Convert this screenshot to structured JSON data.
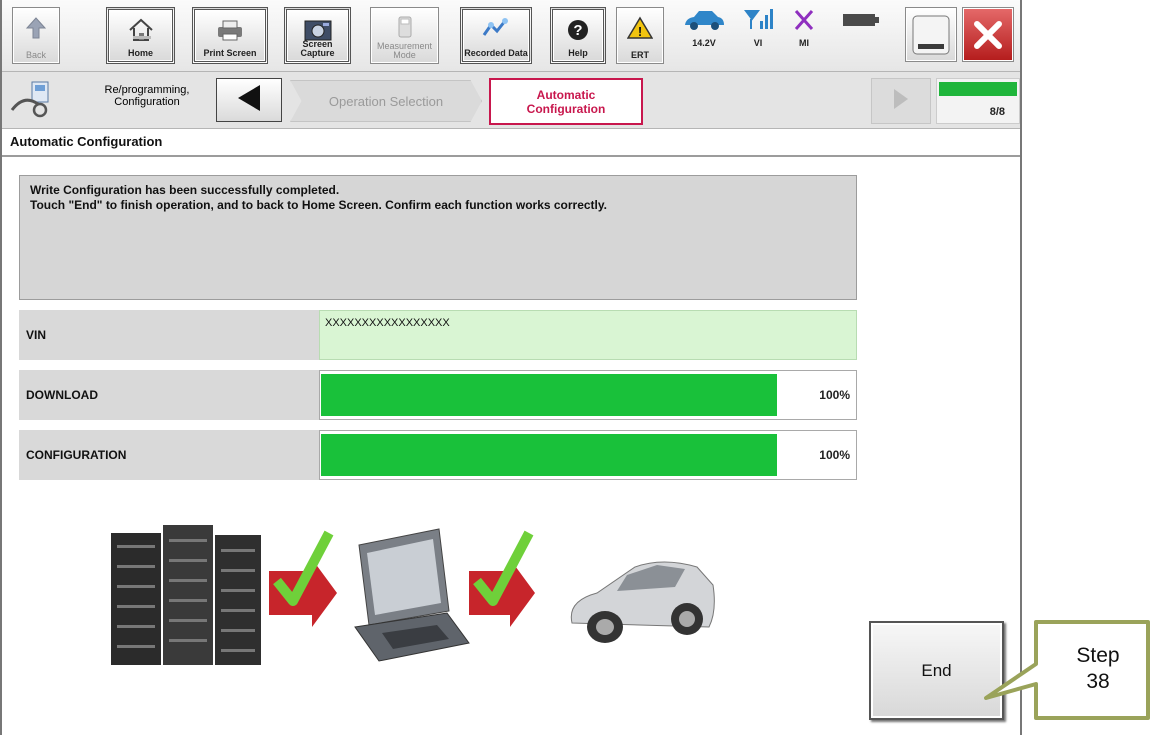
{
  "toolbar": {
    "back": {
      "label": "Back",
      "icon": "back-arrow-icon"
    },
    "home": {
      "label": "Home",
      "icon": "home-icon"
    },
    "print_screen": {
      "label": "Print Screen",
      "icon": "printer-icon"
    },
    "screen_capture": {
      "label": "Screen Capture",
      "icon": "camera-icon"
    },
    "measurement_mode": {
      "label": "Measurement Mode",
      "icon": "meter-icon"
    },
    "recorded_data": {
      "label": "Recorded Data",
      "icon": "recorded-data-icon"
    },
    "help": {
      "label": "Help",
      "icon": "help-icon"
    },
    "ert": {
      "label": "ERT",
      "icon": "warning-icon"
    },
    "battery_voltage": {
      "label": "14.2V",
      "icon": "car-icon"
    },
    "vi": {
      "label": "VI",
      "icon": "signal-icon"
    },
    "mi": {
      "label": "MI",
      "icon": "x-mark-icon"
    },
    "minimize_icon": "minimize-icon",
    "close_icon": "close-icon"
  },
  "navbar": {
    "crumb_1": "Re/programming, Configuration",
    "crumb_2": "Operation Selection",
    "crumb_3_line1": "Automatic",
    "crumb_3_line2": "Configuration",
    "page_indicator": "8/8",
    "progress_fraction": 1.0
  },
  "content": {
    "section_title": "Automatic Configuration",
    "message_line1": "Write Configuration has been successfully completed.",
    "message_line2": "Touch \"End\" to finish operation, and to back to Home Screen. Confirm each function works correctly.",
    "vin_label": "VIN",
    "vin_value": "XXXXXXXXXXXXXXXXX",
    "download_label": "DOWNLOAD",
    "download_percent_text": "100%",
    "download_fraction": 1.0,
    "configuration_label": "CONFIGURATION",
    "configuration_percent_text": "100%",
    "configuration_fraction": 1.0,
    "end_button_label": "End"
  },
  "callout": {
    "line1": "Step",
    "line2": "38"
  },
  "colors": {
    "progress_green": "#19c13a",
    "active_step_red": "#c8174d",
    "vin_background": "#d9f5d3",
    "check_green": "#6fd03a",
    "arrow_red": "#c7252b"
  }
}
